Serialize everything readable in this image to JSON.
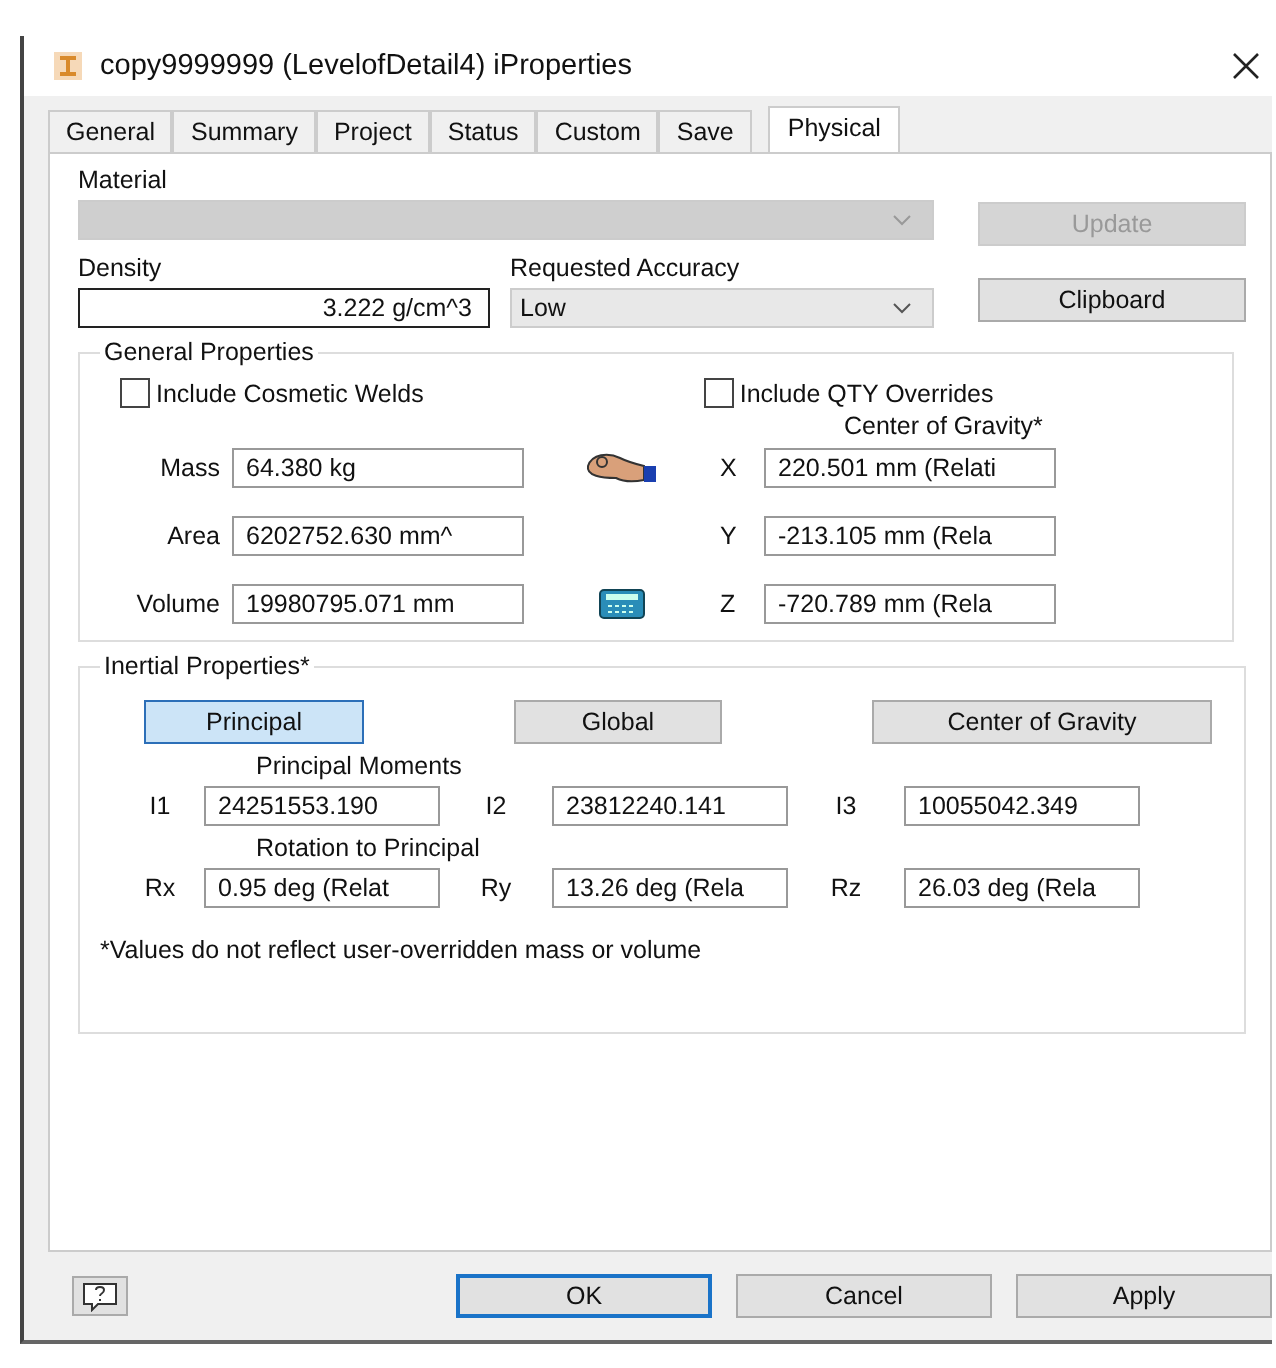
{
  "window": {
    "title": "copy9999999 (LevelofDetail4) iProperties"
  },
  "tabs": [
    {
      "label": "General",
      "selected": false
    },
    {
      "label": "Summary",
      "selected": false
    },
    {
      "label": "Project",
      "selected": false
    },
    {
      "label": "Status",
      "selected": false
    },
    {
      "label": "Custom",
      "selected": false
    },
    {
      "label": "Save",
      "selected": false
    },
    {
      "label": "Physical",
      "selected": true
    }
  ],
  "material": {
    "label": "Material",
    "disabled": true
  },
  "update_button": {
    "label": "Update",
    "disabled": true
  },
  "clipboard_button": {
    "label": "Clipboard",
    "disabled": false
  },
  "density": {
    "label": "Density",
    "value": "3.222 g/cm^3"
  },
  "accuracy": {
    "label": "Requested Accuracy",
    "value": "Low"
  },
  "general_properties": {
    "title": "General Properties",
    "checkboxes": [
      {
        "label": "Include Cosmetic Welds",
        "checked": false
      },
      {
        "label": "Include QTY Overrides",
        "checked": false
      }
    ],
    "cog_label": "Center of Gravity*",
    "fields": [
      {
        "label": "Mass",
        "value": "64.380 kg"
      },
      {
        "label": "Area",
        "value": "6202752.630 mm^"
      },
      {
        "label": "Volume",
        "value": "19980795.071 mm"
      }
    ],
    "cog_fields": [
      {
        "label": "X",
        "value": "220.501 mm (Relati"
      },
      {
        "label": "Y",
        "value": "-213.105 mm (Rela"
      },
      {
        "label": "Z",
        "value": "-720.789 mm (Rela"
      }
    ]
  },
  "inertial_properties": {
    "title": "Inertial Properties*",
    "modes": [
      {
        "label": "Principal",
        "selected": true
      },
      {
        "label": "Global",
        "selected": false
      },
      {
        "label": "Center of Gravity",
        "selected": false
      }
    ],
    "moments_label": "Principal Moments",
    "moments": [
      {
        "label": "I1",
        "value": "24251553.190"
      },
      {
        "label": "I2",
        "value": "23812240.141"
      },
      {
        "label": "I3",
        "value": "10055042.349"
      }
    ],
    "rotation_label": "Rotation to Principal",
    "rotations": [
      {
        "label": "Rx",
        "value": "0.95 deg (Relat"
      },
      {
        "label": "Ry",
        "value": "13.26 deg (Rela"
      },
      {
        "label": "Rz",
        "value": "26.03 deg (Rela"
      }
    ],
    "note": "*Values do not reflect user-overridden mass or volume"
  },
  "footer_buttons": [
    {
      "label": "OK",
      "default": true
    },
    {
      "label": "Cancel",
      "default": false
    },
    {
      "label": "Apply",
      "default": false
    }
  ]
}
